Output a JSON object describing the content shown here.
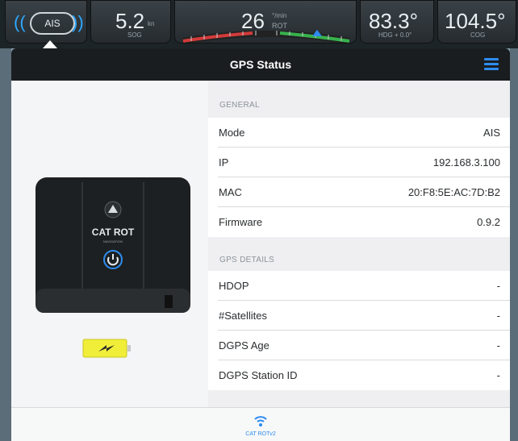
{
  "instruments": {
    "ais_label": "AIS",
    "sog_value": "5.2",
    "sog_unit": "kn",
    "sog_label": "SOG",
    "rot_value": "26",
    "rot_unit": "°/min",
    "rot_label": "ROT",
    "hdg_value": "83.3°",
    "hdg_label": "HDG + 0.0°",
    "cog_value": "104.5°",
    "cog_label": "COG"
  },
  "panel": {
    "title": "GPS Status",
    "device_brand": "CAT ROT",
    "device_sub": "NAVIGATION"
  },
  "general": {
    "header": "GENERAL",
    "rows": [
      {
        "label": "Mode",
        "value": "AIS"
      },
      {
        "label": "IP",
        "value": "192.168.3.100"
      },
      {
        "label": "MAC",
        "value": "20:F8:5E:AC:7D:B2"
      },
      {
        "label": "Firmware",
        "value": "0.9.2"
      }
    ]
  },
  "gps_details": {
    "header": "GPS DETAILS",
    "rows": [
      {
        "label": "HDOP",
        "value": "-"
      },
      {
        "label": "#Satellites",
        "value": "-"
      },
      {
        "label": "DGPS Age",
        "value": "-"
      },
      {
        "label": "DGPS Station ID",
        "value": "-"
      }
    ]
  },
  "tabbar": {
    "tab_label": "CAT ROTv2"
  },
  "colors": {
    "accent": "#2e8cf0",
    "header_bg": "#1a1d20",
    "battery_fill": "#f1ee3a",
    "rot_red": "#d23a3a",
    "rot_green": "#37b24d"
  },
  "icons": {
    "menu": "hamburger-menu-icon",
    "wifi": "wifi-icon",
    "battery": "battery-charging-icon",
    "power": "power-icon",
    "nav_arrow": "navigation-arrow-icon"
  }
}
